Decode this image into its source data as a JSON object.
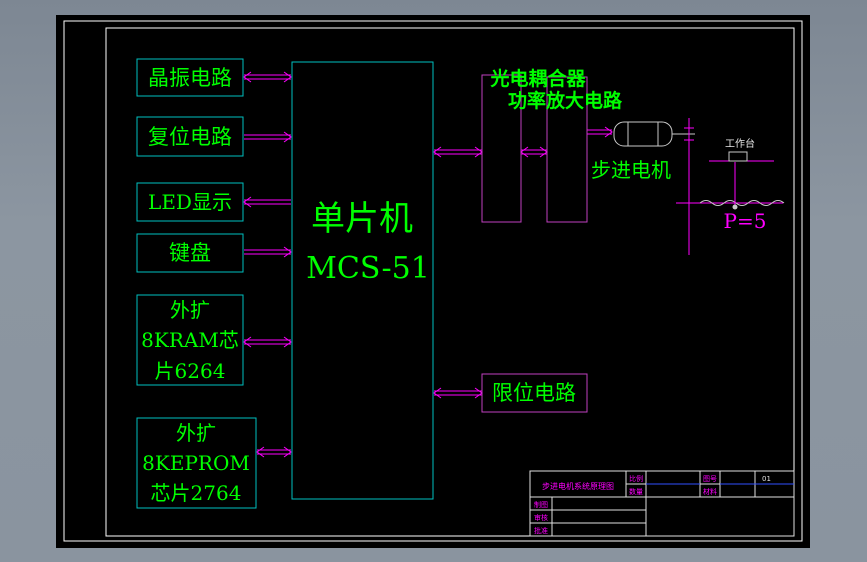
{
  "colors": {
    "background": "#000000",
    "frame": "#ffffff",
    "block_border": "#00c0c0",
    "block_text": "#00ff00",
    "arrow": "#ff00ff",
    "power_border": "#c040c0",
    "table_line": "#e0e0e0",
    "table_text": "#ff00ff"
  },
  "blocks": {
    "crystal": "晶振电路",
    "reset": "复位电路",
    "led": "LED显示",
    "keyboard": "键盘",
    "ram": [
      "外扩",
      "8KRAM芯",
      "片6264"
    ],
    "eprom": [
      "外扩",
      "8KEPROM",
      "芯片2764"
    ],
    "mcu_line1": "单片机",
    "mcu_line2": "MCS-51",
    "opto": "光电耦合器",
    "power_amp": "功率放大电路",
    "limit": "限位电路",
    "motor": "步进电机"
  },
  "mechanism": {
    "workbench": "工作台",
    "pitch": "P=5"
  },
  "title_block": {
    "title": "步进电机系统原理图",
    "scale_label": "比例",
    "qty_label": "数量",
    "sheet_label": "图号",
    "material_label": "材料",
    "sheet_value": "01",
    "designer": "制图",
    "checker": "审核",
    "approver": "批准"
  }
}
